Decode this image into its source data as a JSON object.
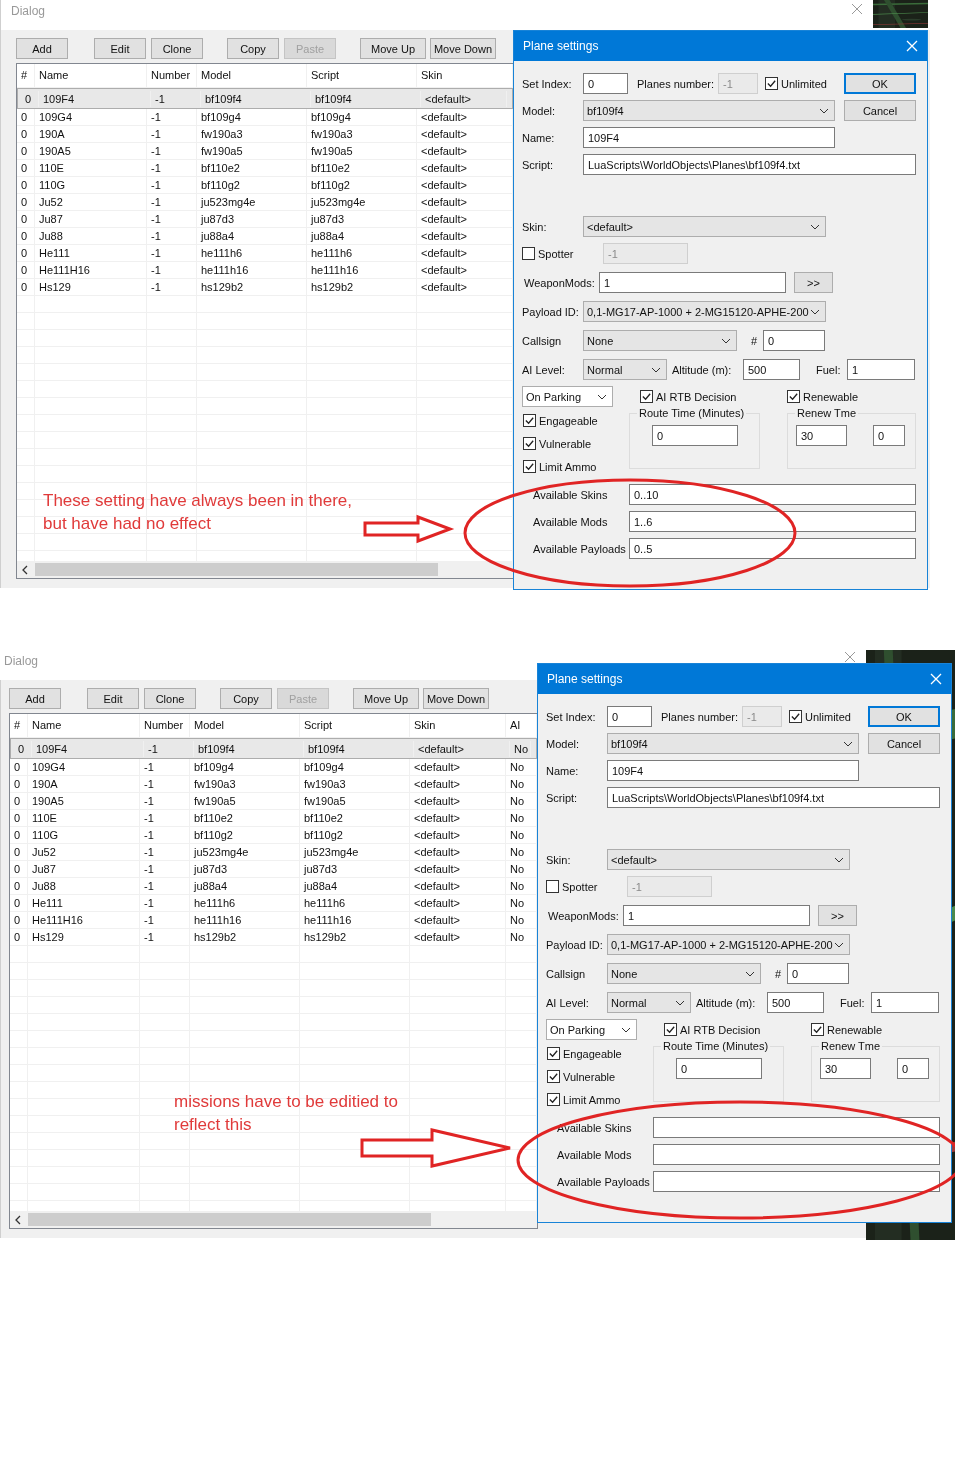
{
  "shots": [
    {
      "window_title": "Dialog",
      "toolbar": [
        {
          "label": "Add",
          "disabled": false
        },
        {
          "label": "Edit",
          "disabled": false
        },
        {
          "label": "Clone",
          "disabled": false
        },
        {
          "label": "Copy",
          "disabled": false
        },
        {
          "label": "Paste",
          "disabled": true
        },
        {
          "label": "Move Up",
          "disabled": false
        },
        {
          "label": "Move Down",
          "disabled": false
        }
      ],
      "table": {
        "columns": [
          "#",
          "Name",
          "Number",
          "Model",
          "Script",
          "Skin"
        ],
        "rows": [
          {
            "selected": true,
            "cells": [
              "0",
              "109F4",
              "-1",
              "bf109f4",
              "bf109f4",
              "<default>"
            ]
          },
          {
            "selected": false,
            "cells": [
              "0",
              "109G4",
              "-1",
              "bf109g4",
              "bf109g4",
              "<default>"
            ]
          },
          {
            "selected": false,
            "cells": [
              "0",
              "190A",
              "-1",
              "fw190a3",
              "fw190a3",
              "<default>"
            ]
          },
          {
            "selected": false,
            "cells": [
              "0",
              "190A5",
              "-1",
              "fw190a5",
              "fw190a5",
              "<default>"
            ]
          },
          {
            "selected": false,
            "cells": [
              "0",
              "110E",
              "-1",
              "bf110e2",
              "bf110e2",
              "<default>"
            ]
          },
          {
            "selected": false,
            "cells": [
              "0",
              "110G",
              "-1",
              "bf110g2",
              "bf110g2",
              "<default>"
            ]
          },
          {
            "selected": false,
            "cells": [
              "0",
              "Ju52",
              "-1",
              "ju523mg4e",
              "ju523mg4e",
              "<default>"
            ]
          },
          {
            "selected": false,
            "cells": [
              "0",
              "Ju87",
              "-1",
              "ju87d3",
              "ju87d3",
              "<default>"
            ]
          },
          {
            "selected": false,
            "cells": [
              "0",
              "Ju88",
              "-1",
              "ju88a4",
              "ju88a4",
              "<default>"
            ]
          },
          {
            "selected": false,
            "cells": [
              "0",
              "He111",
              "-1",
              "he111h6",
              "he111h6",
              "<default>"
            ]
          },
          {
            "selected": false,
            "cells": [
              "0",
              "He111H16",
              "-1",
              "he111h16",
              "he111h16",
              "<default>"
            ]
          },
          {
            "selected": false,
            "cells": [
              "0",
              "Hs129",
              "-1",
              "hs129b2",
              "hs129b2",
              "<default>"
            ]
          }
        ]
      },
      "note": "These setting have always been in there, but have had no effect",
      "plane": {
        "title": "Plane settings",
        "set_index": {
          "label": "Set Index:",
          "value": "0"
        },
        "planes_number": {
          "label": "Planes number:",
          "value": "-1",
          "disabled": true
        },
        "unlimited": {
          "label": "Unlimited",
          "checked": true
        },
        "ok": "OK",
        "cancel": "Cancel",
        "model": {
          "label": "Model:",
          "value": "bf109f4"
        },
        "name": {
          "label": "Name:",
          "value": "109F4"
        },
        "script": {
          "label": "Script:",
          "value": "LuaScripts\\WorldObjects\\Planes\\bf109f4.txt"
        },
        "skin": {
          "label": "Skin:",
          "value": "<default>"
        },
        "spotter": {
          "label": "Spotter",
          "checked": false
        },
        "spotter_count": {
          "value": "-1",
          "disabled": true
        },
        "weapon_mods": {
          "label": "WeaponMods:",
          "value": "1",
          "button": ">>"
        },
        "payload": {
          "label": "Payload ID:",
          "value": "0,1-MG17-AP-1000 + 2-MG15120-APHE-200"
        },
        "callsign": {
          "label": "Callsign",
          "value": "None",
          "hash": "#",
          "number": "0"
        },
        "ai_level": {
          "label": "AI Level:",
          "value": "Normal"
        },
        "altitude": {
          "label": "Altitude (m):",
          "value": "500"
        },
        "fuel": {
          "label": "Fuel:",
          "value": "1"
        },
        "start": {
          "value": "On Parking"
        },
        "ai_rtb": {
          "label": "AI RTB Decision",
          "checked": true
        },
        "renewable": {
          "label": "Renewable",
          "checked": true
        },
        "flags": [
          {
            "label": "Engageable",
            "checked": true
          },
          {
            "label": "Vulnerable",
            "checked": true
          },
          {
            "label": "Limit Ammo",
            "checked": true
          }
        ],
        "route_time": {
          "label": "Route Time (Minutes)",
          "value": "0"
        },
        "renew_time": {
          "label": "Renew Tme",
          "values": [
            "30",
            "0"
          ]
        },
        "available": [
          {
            "label": "Available Skins",
            "value": "0..10"
          },
          {
            "label": "Available Mods",
            "value": "1..6"
          },
          {
            "label": "Available Payloads",
            "value": "0..5"
          }
        ]
      }
    },
    {
      "window_title": "Dialog",
      "toolbar": [
        {
          "label": "Add",
          "disabled": false
        },
        {
          "label": "Edit",
          "disabled": false
        },
        {
          "label": "Clone",
          "disabled": false
        },
        {
          "label": "Copy",
          "disabled": false
        },
        {
          "label": "Paste",
          "disabled": true
        },
        {
          "label": "Move Up",
          "disabled": false
        },
        {
          "label": "Move Down",
          "disabled": false
        }
      ],
      "table": {
        "columns": [
          "#",
          "Name",
          "Number",
          "Model",
          "Script",
          "Skin",
          "AI"
        ],
        "rows": [
          {
            "selected": true,
            "cells": [
              "0",
              "109F4",
              "-1",
              "bf109f4",
              "bf109f4",
              "<default>",
              "No"
            ]
          },
          {
            "selected": false,
            "cells": [
              "0",
              "109G4",
              "-1",
              "bf109g4",
              "bf109g4",
              "<default>",
              "No"
            ]
          },
          {
            "selected": false,
            "cells": [
              "0",
              "190A",
              "-1",
              "fw190a3",
              "fw190a3",
              "<default>",
              "No"
            ]
          },
          {
            "selected": false,
            "cells": [
              "0",
              "190A5",
              "-1",
              "fw190a5",
              "fw190a5",
              "<default>",
              "No"
            ]
          },
          {
            "selected": false,
            "cells": [
              "0",
              "110E",
              "-1",
              "bf110e2",
              "bf110e2",
              "<default>",
              "No"
            ]
          },
          {
            "selected": false,
            "cells": [
              "0",
              "110G",
              "-1",
              "bf110g2",
              "bf110g2",
              "<default>",
              "No"
            ]
          },
          {
            "selected": false,
            "cells": [
              "0",
              "Ju52",
              "-1",
              "ju523mg4e",
              "ju523mg4e",
              "<default>",
              "No"
            ]
          },
          {
            "selected": false,
            "cells": [
              "0",
              "Ju87",
              "-1",
              "ju87d3",
              "ju87d3",
              "<default>",
              "No"
            ]
          },
          {
            "selected": false,
            "cells": [
              "0",
              "Ju88",
              "-1",
              "ju88a4",
              "ju88a4",
              "<default>",
              "No"
            ]
          },
          {
            "selected": false,
            "cells": [
              "0",
              "He111",
              "-1",
              "he111h6",
              "he111h6",
              "<default>",
              "No"
            ]
          },
          {
            "selected": false,
            "cells": [
              "0",
              "He111H16",
              "-1",
              "he111h16",
              "he111h16",
              "<default>",
              "No"
            ]
          },
          {
            "selected": false,
            "cells": [
              "0",
              "Hs129",
              "-1",
              "hs129b2",
              "hs129b2",
              "<default>",
              "No"
            ]
          }
        ]
      },
      "note": "missions have to be editied to reflect this",
      "plane": {
        "title": "Plane settings",
        "set_index": {
          "label": "Set Index:",
          "value": "0"
        },
        "planes_number": {
          "label": "Planes number:",
          "value": "-1",
          "disabled": true
        },
        "unlimited": {
          "label": "Unlimited",
          "checked": true
        },
        "ok": "OK",
        "cancel": "Cancel",
        "model": {
          "label": "Model:",
          "value": "bf109f4"
        },
        "name": {
          "label": "Name:",
          "value": "109F4"
        },
        "script": {
          "label": "Script:",
          "value": "LuaScripts\\WorldObjects\\Planes\\bf109f4.txt"
        },
        "skin": {
          "label": "Skin:",
          "value": "<default>"
        },
        "spotter": {
          "label": "Spotter",
          "checked": false
        },
        "spotter_count": {
          "value": "-1",
          "disabled": true
        },
        "weapon_mods": {
          "label": "WeaponMods:",
          "value": "1",
          "button": ">>"
        },
        "payload": {
          "label": "Payload ID:",
          "value": "0,1-MG17-AP-1000 + 2-MG15120-APHE-200"
        },
        "callsign": {
          "label": "Callsign",
          "value": "None",
          "hash": "#",
          "number": "0"
        },
        "ai_level": {
          "label": "AI Level:",
          "value": "Normal"
        },
        "altitude": {
          "label": "Altitude (m):",
          "value": "500"
        },
        "fuel": {
          "label": "Fuel:",
          "value": "1"
        },
        "start": {
          "value": "On Parking"
        },
        "ai_rtb": {
          "label": "AI RTB Decision",
          "checked": true
        },
        "renewable": {
          "label": "Renewable",
          "checked": true
        },
        "flags": [
          {
            "label": "Engageable",
            "checked": true
          },
          {
            "label": "Vulnerable",
            "checked": true
          },
          {
            "label": "Limit Ammo",
            "checked": true
          }
        ],
        "route_time": {
          "label": "Route Time (Minutes)",
          "value": "0"
        },
        "renew_time": {
          "label": "Renew Tme",
          "values": [
            "30",
            "0"
          ]
        },
        "available": [
          {
            "label": "Available Skins"
          },
          {
            "label": "Available Mods"
          },
          {
            "label": "Available Payloads"
          }
        ]
      }
    }
  ]
}
